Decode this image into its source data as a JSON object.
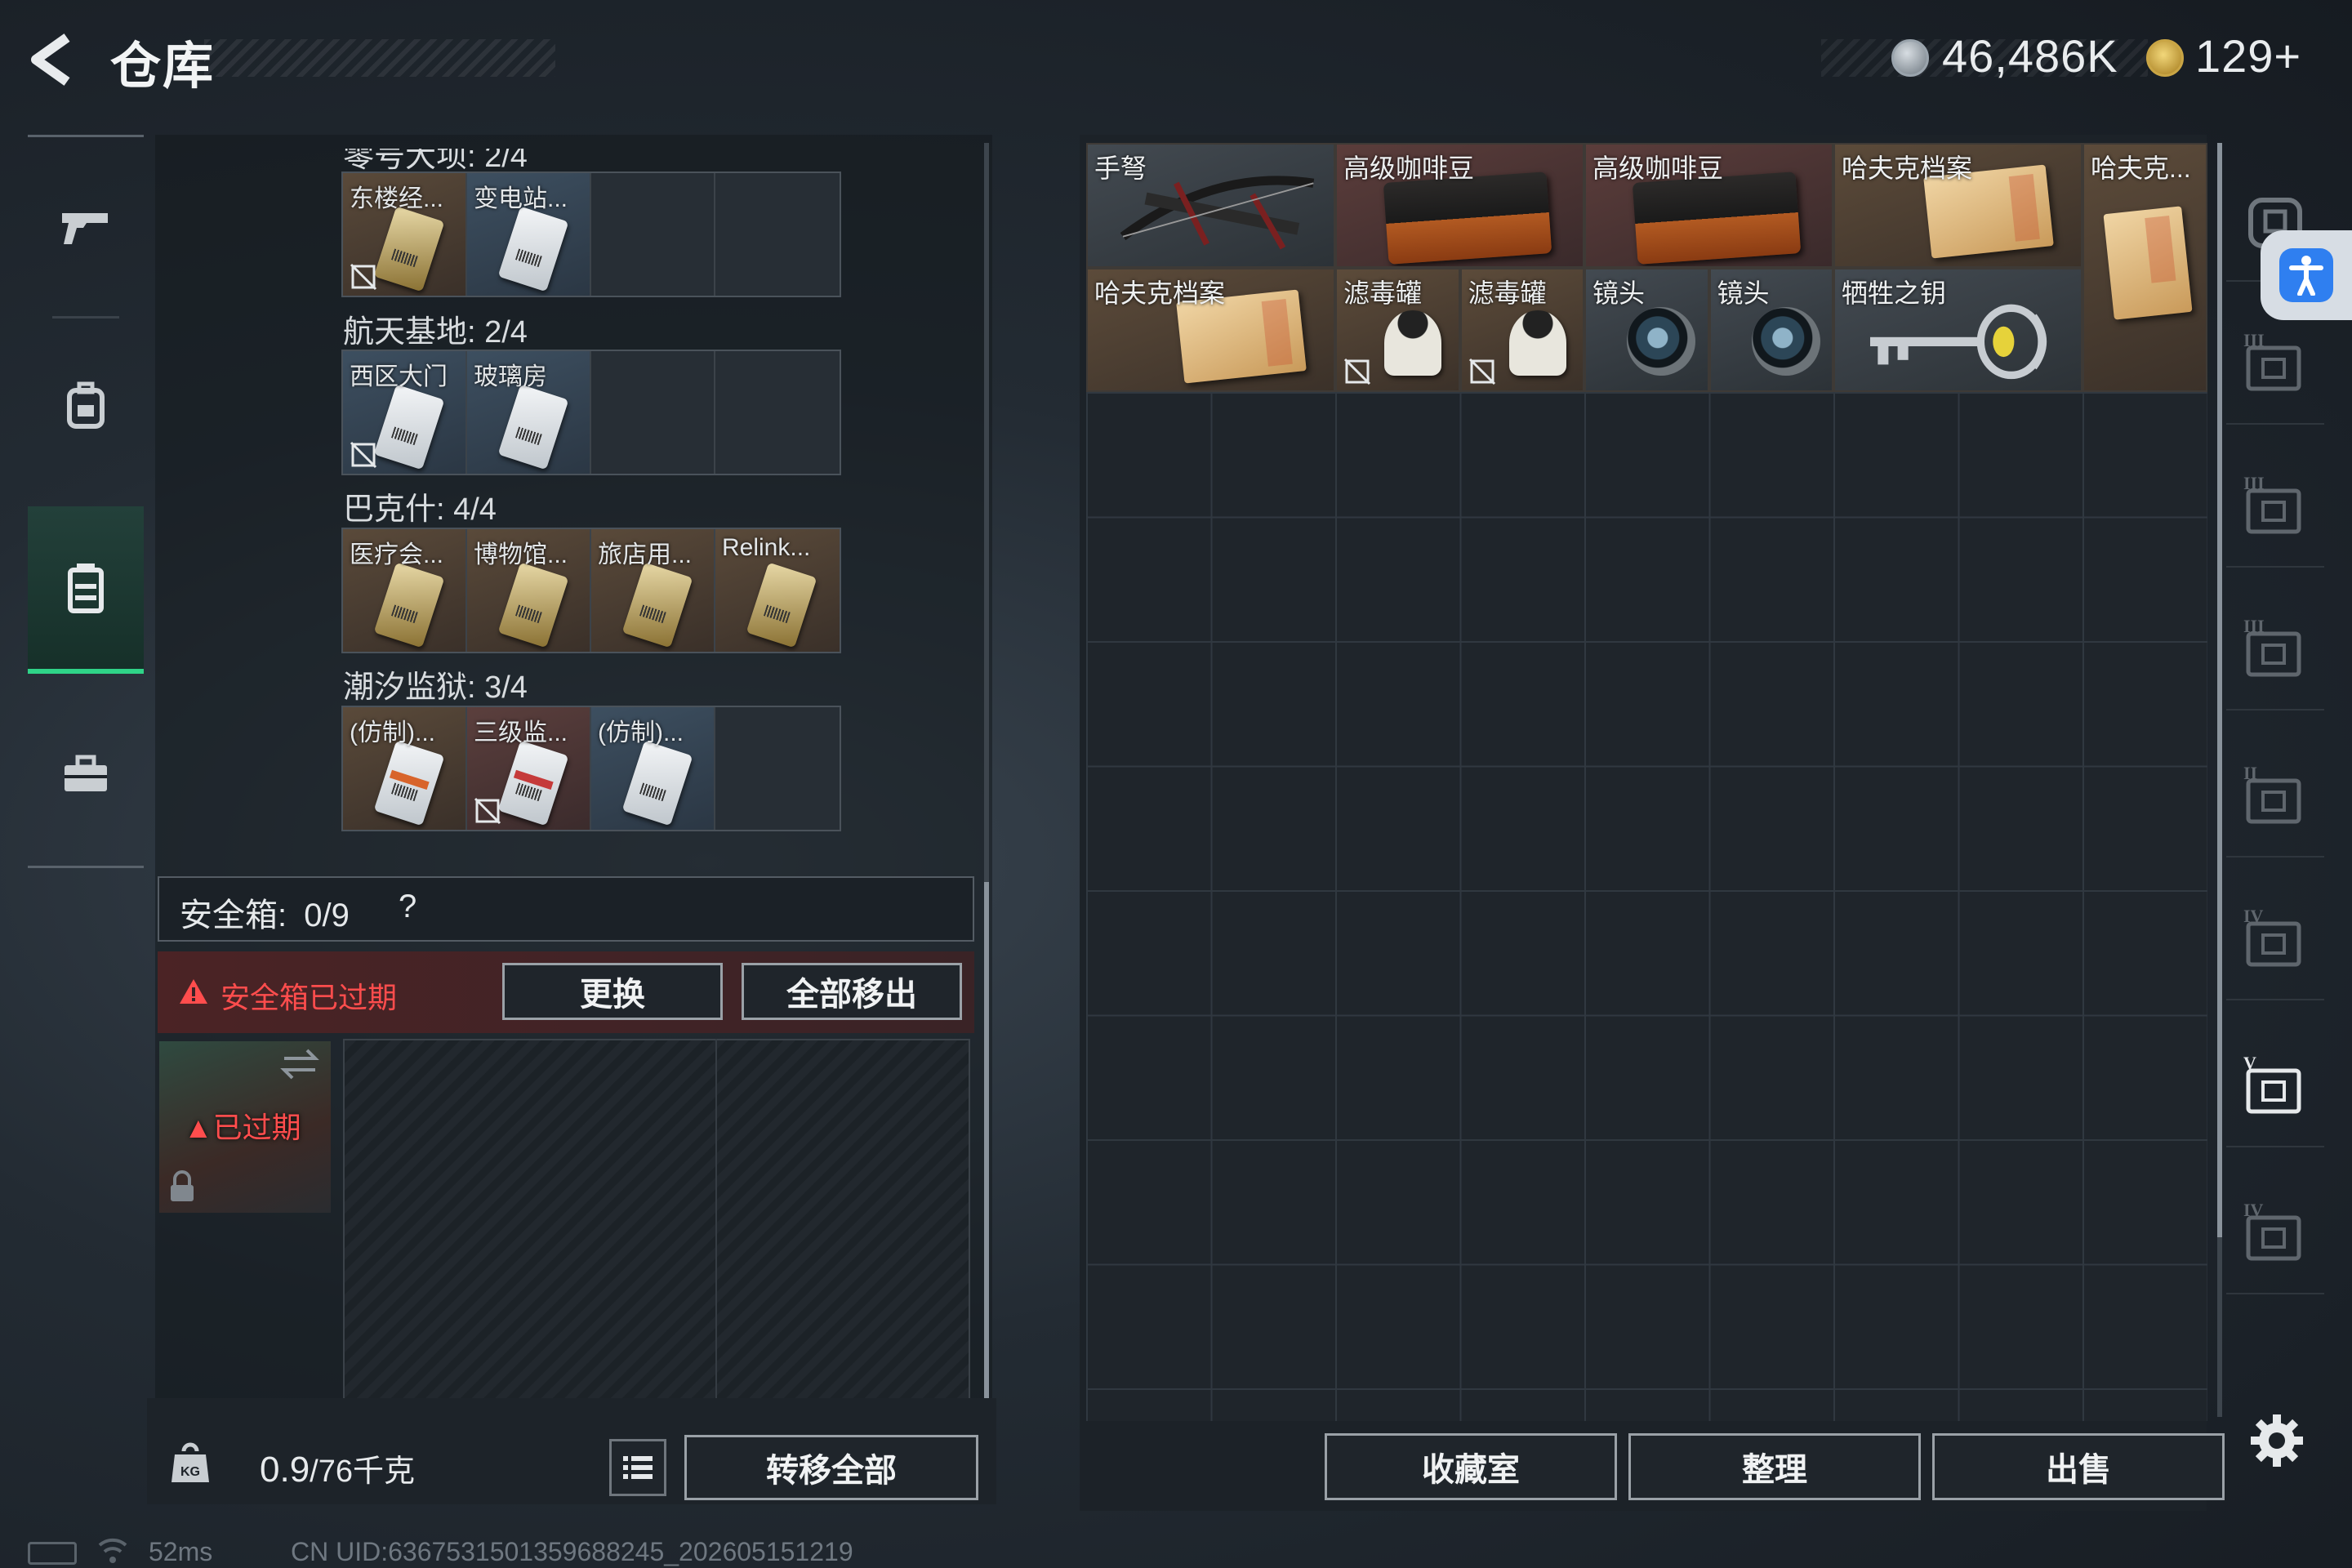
{
  "header": {
    "title": "仓库",
    "coins": "46,486K",
    "gems": "129+"
  },
  "left_nav": {
    "items": [
      "gun-icon",
      "backpack-icon",
      "vest-icon",
      "toolbox-icon"
    ],
    "active": "vest-icon"
  },
  "key_groups": [
    {
      "title": "零号大坝: 2/4",
      "slots": [
        {
          "label": "东楼经...",
          "color": "tan",
          "card": "gold",
          "locked": true
        },
        {
          "label": "变电站...",
          "color": "blue",
          "card": "white",
          "locked": false
        },
        {
          "label": "",
          "color": "empty"
        },
        {
          "label": "",
          "color": "empty"
        }
      ]
    },
    {
      "title": "航天基地: 2/4",
      "slots": [
        {
          "label": "西区大门",
          "color": "blue",
          "card": "white",
          "locked": true
        },
        {
          "label": "玻璃房",
          "color": "blue",
          "card": "white",
          "locked": false
        },
        {
          "label": "",
          "color": "empty"
        },
        {
          "label": "",
          "color": "empty"
        }
      ]
    },
    {
      "title": "巴克什: 4/4",
      "slots": [
        {
          "label": "医疗会...",
          "color": "tan",
          "card": "gold",
          "locked": false
        },
        {
          "label": "博物馆...",
          "color": "tan",
          "card": "gold",
          "locked": false
        },
        {
          "label": "旅店用...",
          "color": "tan",
          "card": "gold",
          "locked": false
        },
        {
          "label": "Relink...",
          "color": "tan",
          "card": "gold",
          "locked": false
        }
      ]
    },
    {
      "title": "潮汐监狱: 3/4",
      "slots": [
        {
          "label": "(仿制)...",
          "color": "tan",
          "card": "orange",
          "locked": false
        },
        {
          "label": "三级监...",
          "color": "rose",
          "card": "red",
          "locked": true
        },
        {
          "label": "(仿制)...",
          "color": "blue",
          "card": "white",
          "locked": false
        },
        {
          "label": "",
          "color": "empty"
        }
      ]
    }
  ],
  "safe_box": {
    "title": "安全箱:",
    "capacity": "0/9",
    "help": "?",
    "expired_warning": "安全箱已过期",
    "replace_label": "更换",
    "remove_all_label": "全部移出",
    "case_status": "已过期"
  },
  "bottom_left": {
    "weight": "0.9",
    "weight_unit": "/76千克",
    "transfer_all_label": "转移全部"
  },
  "stash_items": [
    {
      "label": "手弩",
      "kind": "crossbow",
      "color": "gray"
    },
    {
      "label": "高级咖啡豆",
      "kind": "coffee",
      "color": "rose"
    },
    {
      "label": "高级咖啡豆",
      "kind": "coffee",
      "color": "rose"
    },
    {
      "label": "哈夫克档案",
      "kind": "folder",
      "color": "tan"
    },
    {
      "label": "哈夫克...",
      "kind": "folder",
      "color": "tan"
    },
    {
      "label": "哈夫克档案",
      "kind": "folder",
      "color": "tan"
    },
    {
      "label": "滤毒罐",
      "kind": "filter",
      "color": "tan",
      "locked": true
    },
    {
      "label": "滤毒罐",
      "kind": "filter",
      "color": "tan",
      "locked": true
    },
    {
      "label": "镜头",
      "kind": "lens",
      "color": "gray"
    },
    {
      "label": "镜头",
      "kind": "lens",
      "color": "gray"
    },
    {
      "label": "牺牲之钥",
      "kind": "key",
      "color": "gray"
    }
  ],
  "right_nav": {
    "tiers": [
      "III",
      "III",
      "III",
      "II",
      "IV",
      "V",
      "IV"
    ]
  },
  "bottom_right": {
    "collection_label": "收藏室",
    "organize_label": "整理",
    "sell_label": "出售"
  },
  "status": {
    "ping": "52ms",
    "uid": "CN UID:6367531501359688245_202605151219"
  },
  "colors": {
    "accent_green": "#2fd488",
    "warning_red": "#ff4d4d",
    "accessibility_blue": "#2f7ff0"
  }
}
